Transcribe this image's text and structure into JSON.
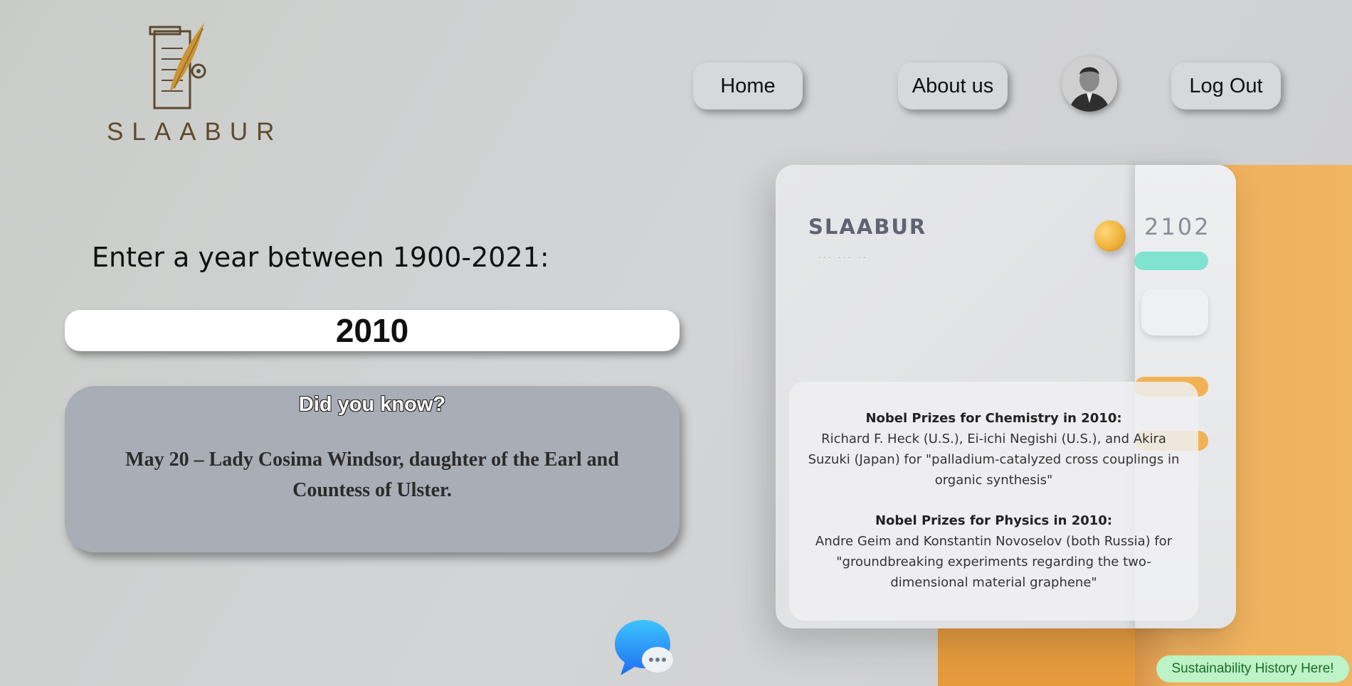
{
  "logo": {
    "text": "SLAABUR",
    "icon": "quill-scroll-icon"
  },
  "nav": {
    "home": "Home",
    "about": "About us",
    "logout": "Log Out",
    "avatar": "user-avatar"
  },
  "prompt": "Enter a year between 1900-2021:",
  "year_input": {
    "value": "2010"
  },
  "fact": {
    "title": "Did you know?",
    "text": "May 20 – Lady Cosima Windsor, daughter of the Earl and Countess of Ulster."
  },
  "background_calendar": {
    "brand": "SLAABUR",
    "year": "2102"
  },
  "nobel": [
    {
      "heading": "Nobel Prizes for Chemistry in 2010:",
      "text": "Richard F. Heck (U.S.), Ei-ichi Negishi (U.S.), and Akira Suzuki (Japan) for \"palladium-catalyzed cross couplings in organic synthesis\""
    },
    {
      "heading": "Nobel Prizes for Physics in 2010:",
      "text": "Andre Geim and Konstantin Novoselov (both Russia) for \"groundbreaking experiments regarding the two-dimensional material graphene\""
    }
  ],
  "chat": {
    "icon": "chat-bubble-icon"
  },
  "footer": {
    "sustainability": "Sustainability History Here!"
  },
  "colors": {
    "accent_orange": "#eca84c",
    "fact_card": "#a9adb6",
    "sustain_button": "#bdf3c6",
    "teal": "#7fe3cf"
  }
}
